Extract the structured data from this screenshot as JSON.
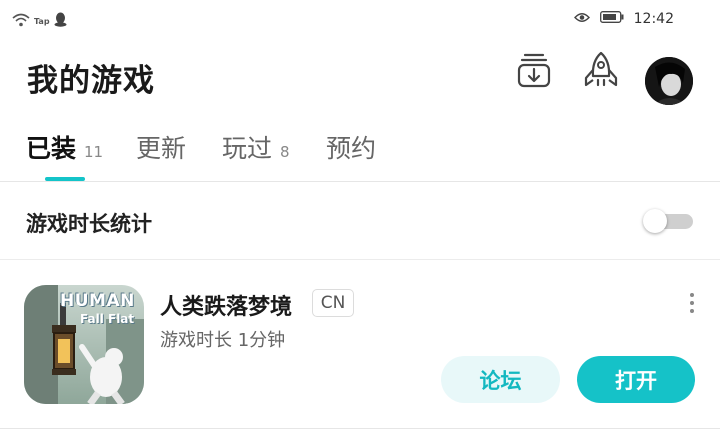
{
  "status_bar": {
    "carrier_badge": "Tap",
    "time": "12:42"
  },
  "header": {
    "title": "我的游戏"
  },
  "tabs": [
    {
      "label": "已装",
      "count": "11",
      "active": true
    },
    {
      "label": "更新",
      "count": ""
    },
    {
      "label": "玩过",
      "count": "8"
    },
    {
      "label": "预约",
      "count": ""
    }
  ],
  "stats": {
    "label": "游戏时长统计",
    "toggle_on": false
  },
  "game": {
    "title": "人类跌落梦境",
    "region": "CN",
    "playtime": "游戏时长 1分钟",
    "icon_line1": "HUMAN",
    "icon_line2": "Fall Flat",
    "forum_button": "论坛",
    "open_button": "打开"
  },
  "colors": {
    "accent": "#15c2c8",
    "accent_light": "#e8f8f9"
  }
}
